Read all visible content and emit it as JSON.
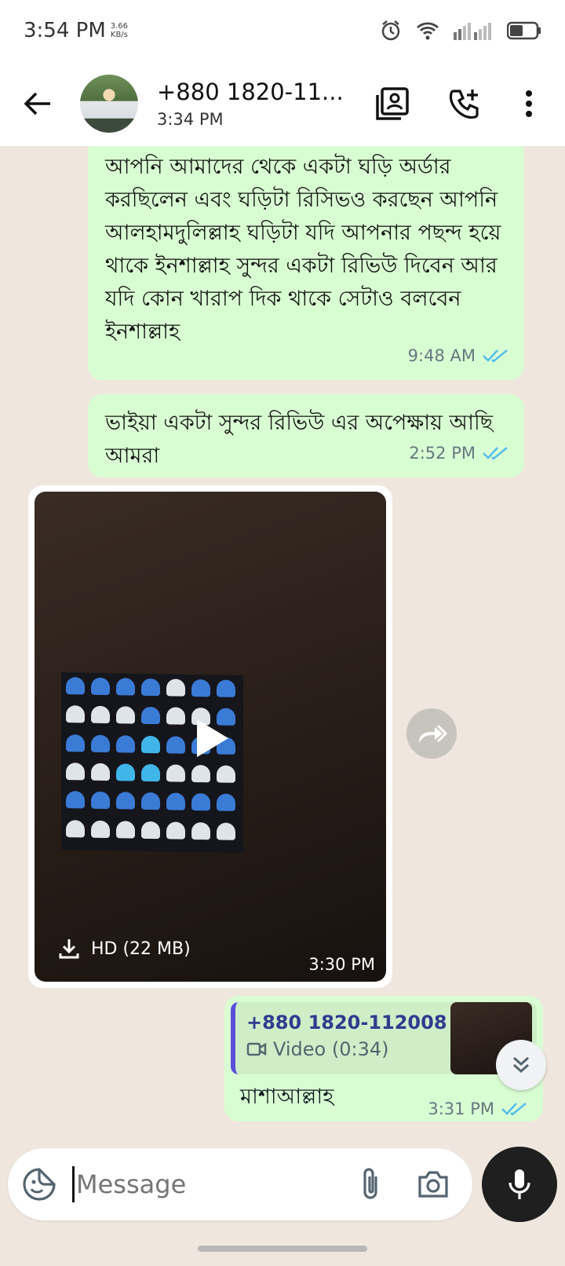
{
  "status_bar": {
    "time": "3:54 PM",
    "net_speed_value": "3.66",
    "net_speed_unit": "KB/s"
  },
  "header": {
    "contact_name": "+880 1820-11...",
    "last_seen": "3:34 PM"
  },
  "messages": [
    {
      "text": "আপনি আমাদের থেকে একটা ঘড়ি অর্ডার করছিলেন এবং ঘড়িটা রিসিভও করছেন আপনি আলহামদুলিল্লাহ ঘড়িটা যদি আপনার পছন্দ হয়ে থাকে ইনশাল্লাহ সুন্দর একটা রিভিউ দিবেন আর যদি কোন খারাপ দিক থাকে সেটাও বলবেন ইনশাল্লাহ",
      "time": "9:48 AM"
    },
    {
      "text": "ভাইয়া একটা সুন্দর রিভিউ এর অপেক্ষায় আছি আমরা",
      "time": "2:52 PM"
    }
  ],
  "video_message": {
    "label": "HD (22 MB)",
    "time": "3:30 PM"
  },
  "reply_message": {
    "quoted_sender": "+880 1820-112008",
    "quoted_type": "Video (0:34)",
    "text": "মাশাআল্লাহ",
    "time": "3:31 PM"
  },
  "composer": {
    "placeholder": "Message"
  },
  "colors": {
    "outgoing_bubble": "#d9fdd3",
    "read_tick": "#53bdeb",
    "quote_bar": "#5b4fd9"
  }
}
